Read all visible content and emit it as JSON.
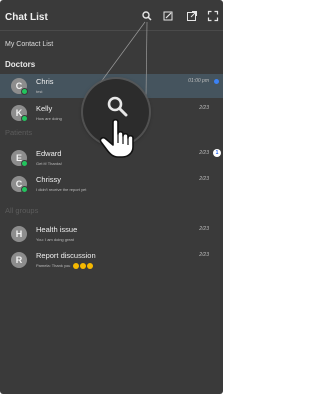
{
  "header": {
    "title": "Chat List",
    "icons": [
      "search-icon",
      "edit-icon",
      "external-link-icon",
      "fullscreen-icon"
    ]
  },
  "subtitle": "My Contact List",
  "sections": {
    "doctors": "Doctors",
    "patients": "Patients",
    "groups": "All groups"
  },
  "contacts": [
    {
      "initial": "C",
      "name": "Chris",
      "preview": "test",
      "time": "01:00 pm",
      "unread_dot": true
    },
    {
      "initial": "K",
      "name": "Kelly",
      "preview": "How are doing",
      "time": "2/23"
    },
    {
      "initial": "E",
      "name": "Edward",
      "preview": "Get it! Thanks!",
      "time": "2/23",
      "badge": "1"
    },
    {
      "initial": "C",
      "name": "Chrissy",
      "preview": "I didn't receive the report yet",
      "time": "2/23"
    },
    {
      "initial": "H",
      "name": "Health issue",
      "preview": "You: I am doing great",
      "time": "2/23"
    },
    {
      "initial": "R",
      "name": "Report discussion",
      "preview": "Pamela: Thank you",
      "time": "2/23"
    }
  ],
  "colors": {
    "panel_bg": "#3a3a3a",
    "selected_row": "#45545e",
    "online": "#22c55e",
    "unread": "#3b82f6"
  }
}
